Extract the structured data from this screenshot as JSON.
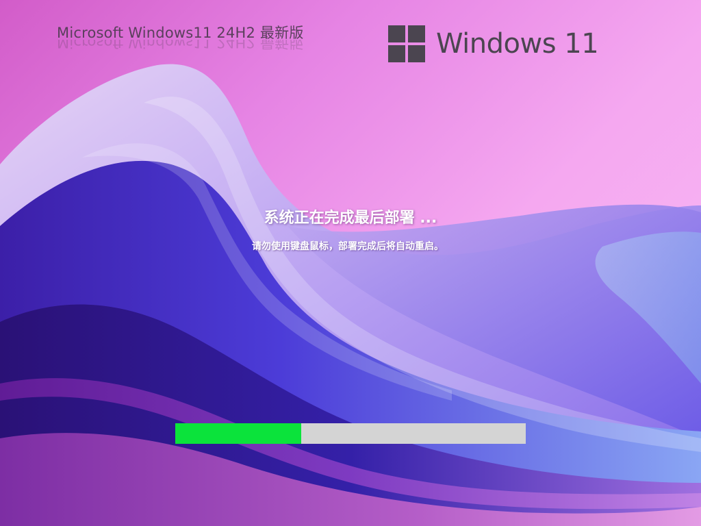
{
  "header": {
    "edition_title": "Microsoft  Windows11 24H2 最新版",
    "brand_name": "Windows 11",
    "brand_icon": "windows-logo-icon"
  },
  "status": {
    "heading": "系统正在完成最后部署 ...",
    "subtext": "请勿使用键盘鼠标，部署完成后将自动重启。"
  },
  "progress": {
    "fraction": 0.36,
    "fill_color": "#0be33b",
    "track_color": "#d4d4d4"
  },
  "colors": {
    "brand_text": "#4b4550",
    "title_text": "#5a3f5c"
  }
}
